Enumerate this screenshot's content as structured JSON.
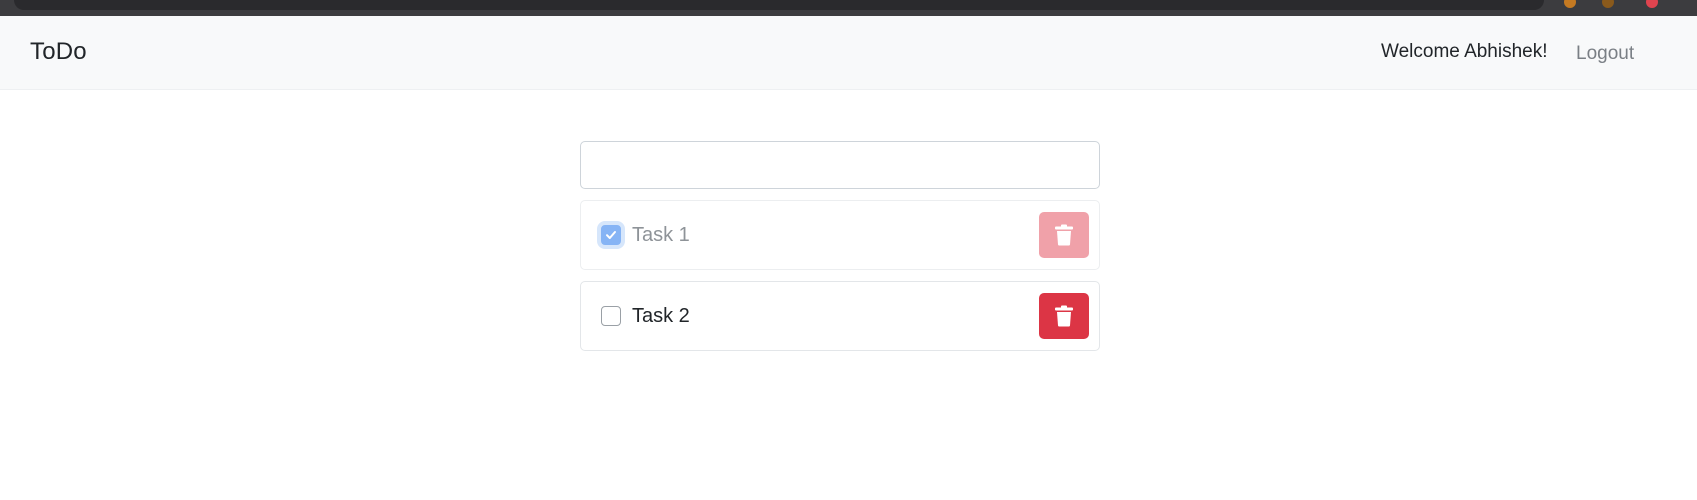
{
  "navbar": {
    "brand": "ToDo",
    "welcome": "Welcome Abhishek!",
    "logout_label": "Logout"
  },
  "new_task_input": {
    "value": "",
    "placeholder": ""
  },
  "tasks": [
    {
      "label": "Task 1",
      "completed": true,
      "delete_icon": "trash-icon"
    },
    {
      "label": "Task 2",
      "completed": false,
      "delete_icon": "trash-icon"
    }
  ],
  "colors": {
    "navbar_bg": "#f8f9fa",
    "danger": "#dc3545",
    "danger_faded": "#f0a1a9",
    "checkbox_checked": "#86b4f5",
    "muted_text": "#8e9398"
  }
}
